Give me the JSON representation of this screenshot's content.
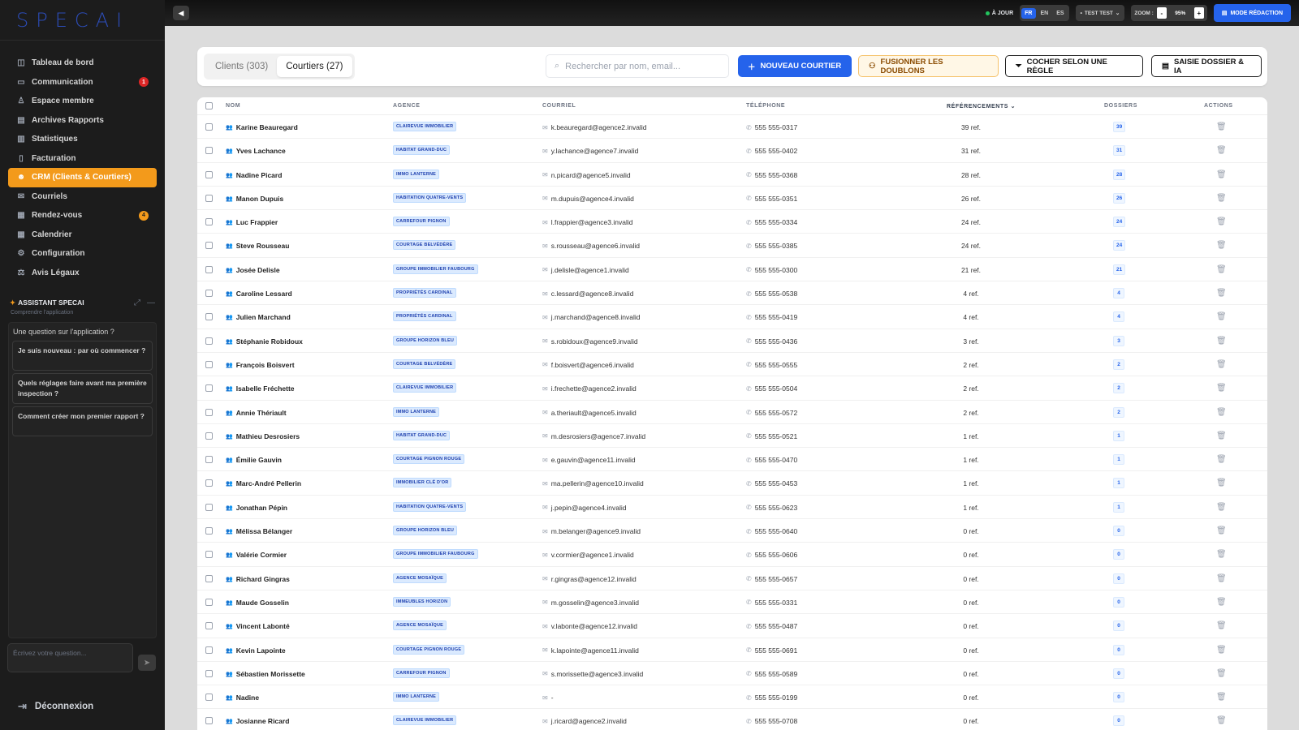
{
  "app": {
    "logo": "SPECAI"
  },
  "sidebar": {
    "items": [
      {
        "label": "Tableau de bord",
        "icon": "dashboard-icon",
        "glyph": "◫",
        "badge": ""
      },
      {
        "label": "Communication",
        "icon": "chat-icon",
        "glyph": "▭",
        "badge": "1",
        "badge_color": "red"
      },
      {
        "label": "Espace membre",
        "icon": "member-icon",
        "glyph": "♙",
        "badge": ""
      },
      {
        "label": "Archives Rapports",
        "icon": "archive-icon",
        "glyph": "▤",
        "badge": ""
      },
      {
        "label": "Statistiques",
        "icon": "stats-icon",
        "glyph": "▥",
        "badge": ""
      },
      {
        "label": "Facturation",
        "icon": "billing-icon",
        "glyph": "▯",
        "badge": ""
      },
      {
        "label": "CRM (Clients & Courtiers)",
        "icon": "users-icon",
        "glyph": "☻",
        "badge": "",
        "active": true
      },
      {
        "label": "Courriels",
        "icon": "mail-icon",
        "glyph": "✉",
        "badge": ""
      },
      {
        "label": "Rendez-vous",
        "icon": "calendar-icon",
        "glyph": "▦",
        "badge": "4",
        "badge_color": "orange"
      },
      {
        "label": "Calendrier",
        "icon": "calendar-icon",
        "glyph": "▦",
        "badge": ""
      },
      {
        "label": "Configuration",
        "icon": "gear-icon",
        "glyph": "⚙",
        "badge": ""
      },
      {
        "label": "Avis Légaux",
        "icon": "legal-icon",
        "glyph": "⚖",
        "badge": ""
      }
    ],
    "assistant": {
      "title": "ASSISTANT SPECAI",
      "subtitle": "Comprendre l'application",
      "question": "Une question sur l'application ?",
      "suggestions": [
        "Je suis nouveau : par où commencer ?",
        "Quels réglages faire avant ma première inspection ?",
        "Comment créer mon premier rapport ?"
      ],
      "input_placeholder": "Écrivez votre question..."
    },
    "logout": "Déconnexion"
  },
  "topbar": {
    "status": "À JOUR",
    "languages": [
      "FR",
      "EN",
      "ES"
    ],
    "active_language": "FR",
    "user": "TEST TEST",
    "zoom_label": "ZOOM :",
    "zoom_value": "95%",
    "mode_button": "MODE RÉDACTION"
  },
  "toolbar": {
    "tabs": [
      "Clients (303)",
      "Courtiers (27)"
    ],
    "active_tab": 1,
    "search_placeholder": "Rechercher par nom, email...",
    "new_button": "NOUVEAU COURTIER",
    "merge_button": "FUSIONNER LES DOUBLONS",
    "rule_button": "COCHER SELON UNE RÈGLE",
    "ai_button": "SAISIE DOSSIER & IA"
  },
  "table": {
    "headers": {
      "name": "NOM",
      "agency": "AGENCE",
      "email": "COURRIEL",
      "phone": "TÉLÉPHONE",
      "refs": "RÉFÉRENCEMENTS",
      "dossiers": "DOSSIERS",
      "actions": "ACTIONS"
    },
    "rows": [
      {
        "name": "Karine Beauregard",
        "agency": "CLAIREVUE IMMOBILIER",
        "email": "k.beauregard@agence2.invalid",
        "phone": "555 555-0317",
        "refs": "39 ref.",
        "dossiers": "39"
      },
      {
        "name": "Yves Lachance",
        "agency": "HABITAT GRAND-DUC",
        "email": "y.lachance@agence7.invalid",
        "phone": "555 555-0402",
        "refs": "31 ref.",
        "dossiers": "31"
      },
      {
        "name": "Nadine Picard",
        "agency": "IMMO LANTERNE",
        "email": "n.picard@agence5.invalid",
        "phone": "555 555-0368",
        "refs": "28 ref.",
        "dossiers": "28"
      },
      {
        "name": "Manon Dupuis",
        "agency": "HABITATION QUATRE-VENTS",
        "email": "m.dupuis@agence4.invalid",
        "phone": "555 555-0351",
        "refs": "26 ref.",
        "dossiers": "26"
      },
      {
        "name": "Luc Frappier",
        "agency": "CARREFOUR PIGNON",
        "email": "l.frappier@agence3.invalid",
        "phone": "555 555-0334",
        "refs": "24 ref.",
        "dossiers": "24"
      },
      {
        "name": "Steve Rousseau",
        "agency": "COURTAGE BELVÉDÈRE",
        "email": "s.rousseau@agence6.invalid",
        "phone": "555 555-0385",
        "refs": "24 ref.",
        "dossiers": "24"
      },
      {
        "name": "Josée Delisle",
        "agency": "GROUPE IMMOBILIER FAUBOURG",
        "email": "j.delisle@agence1.invalid",
        "phone": "555 555-0300",
        "refs": "21 ref.",
        "dossiers": "21"
      },
      {
        "name": "Caroline Lessard",
        "agency": "PROPRIÉTÉS CARDINAL",
        "email": "c.lessard@agence8.invalid",
        "phone": "555 555-0538",
        "refs": "4 ref.",
        "dossiers": "4"
      },
      {
        "name": "Julien Marchand",
        "agency": "PROPRIÉTÉS CARDINAL",
        "email": "j.marchand@agence8.invalid",
        "phone": "555 555-0419",
        "refs": "4 ref.",
        "dossiers": "4"
      },
      {
        "name": "Stéphanie Robidoux",
        "agency": "GROUPE HORIZON BLEU",
        "email": "s.robidoux@agence9.invalid",
        "phone": "555 555-0436",
        "refs": "3 ref.",
        "dossiers": "3"
      },
      {
        "name": "François Boisvert",
        "agency": "COURTAGE BELVÉDÈRE",
        "email": "f.boisvert@agence6.invalid",
        "phone": "555 555-0555",
        "refs": "2 ref.",
        "dossiers": "2"
      },
      {
        "name": "Isabelle Fréchette",
        "agency": "CLAIREVUE IMMOBILIER",
        "email": "i.frechette@agence2.invalid",
        "phone": "555 555-0504",
        "refs": "2 ref.",
        "dossiers": "2"
      },
      {
        "name": "Annie Thériault",
        "agency": "IMMO LANTERNE",
        "email": "a.theriault@agence5.invalid",
        "phone": "555 555-0572",
        "refs": "2 ref.",
        "dossiers": "2"
      },
      {
        "name": "Mathieu Desrosiers",
        "agency": "HABITAT GRAND-DUC",
        "email": "m.desrosiers@agence7.invalid",
        "phone": "555 555-0521",
        "refs": "1 ref.",
        "dossiers": "1"
      },
      {
        "name": "Émilie Gauvin",
        "agency": "COURTAGE PIGNON ROUGE",
        "email": "e.gauvin@agence11.invalid",
        "phone": "555 555-0470",
        "refs": "1 ref.",
        "dossiers": "1"
      },
      {
        "name": "Marc-André Pellerin",
        "agency": "IMMOBILIER CLÉ D'OR",
        "email": "ma.pellerin@agence10.invalid",
        "phone": "555 555-0453",
        "refs": "1 ref.",
        "dossiers": "1"
      },
      {
        "name": "Jonathan Pépin",
        "agency": "HABITATION QUATRE-VENTS",
        "email": "j.pepin@agence4.invalid",
        "phone": "555 555-0623",
        "refs": "1 ref.",
        "dossiers": "1"
      },
      {
        "name": "Mélissa Bélanger",
        "agency": "GROUPE HORIZON BLEU",
        "email": "m.belanger@agence9.invalid",
        "phone": "555 555-0640",
        "refs": "0 ref.",
        "dossiers": "0"
      },
      {
        "name": "Valérie Cormier",
        "agency": "GROUPE IMMOBILIER FAUBOURG",
        "email": "v.cormier@agence1.invalid",
        "phone": "555 555-0606",
        "refs": "0 ref.",
        "dossiers": "0"
      },
      {
        "name": "Richard Gingras",
        "agency": "AGENCE MOSAÏQUE",
        "email": "r.gingras@agence12.invalid",
        "phone": "555 555-0657",
        "refs": "0 ref.",
        "dossiers": "0"
      },
      {
        "name": "Maude Gosselin",
        "agency": "IMMEUBLES HORIZON",
        "email": "m.gosselin@agence3.invalid",
        "phone": "555 555-0331",
        "refs": "0 ref.",
        "dossiers": "0"
      },
      {
        "name": "Vincent Labonté",
        "agency": "AGENCE MOSAÏQUE",
        "email": "v.labonte@agence12.invalid",
        "phone": "555 555-0487",
        "refs": "0 ref.",
        "dossiers": "0"
      },
      {
        "name": "Kevin Lapointe",
        "agency": "COURTAGE PIGNON ROUGE",
        "email": "k.lapointe@agence11.invalid",
        "phone": "555 555-0691",
        "refs": "0 ref.",
        "dossiers": "0"
      },
      {
        "name": "Sébastien Morissette",
        "agency": "CARREFOUR PIGNON",
        "email": "s.morissette@agence3.invalid",
        "phone": "555 555-0589",
        "refs": "0 ref.",
        "dossiers": "0"
      },
      {
        "name": "Nadine",
        "agency": "IMMO LANTERNE",
        "email": "-",
        "phone": "555 555-0199",
        "refs": "0 ref.",
        "dossiers": "0"
      },
      {
        "name": "Josianne Ricard",
        "agency": "CLAIREVUE IMMOBILIER",
        "email": "j.ricard@agence2.invalid",
        "phone": "555 555-0708",
        "refs": "0 ref.",
        "dossiers": "0"
      }
    ]
  },
  "colors": {
    "accent": "#f39a1b",
    "primary": "#2563eb",
    "sidebar_bg": "#1c1c1c"
  }
}
